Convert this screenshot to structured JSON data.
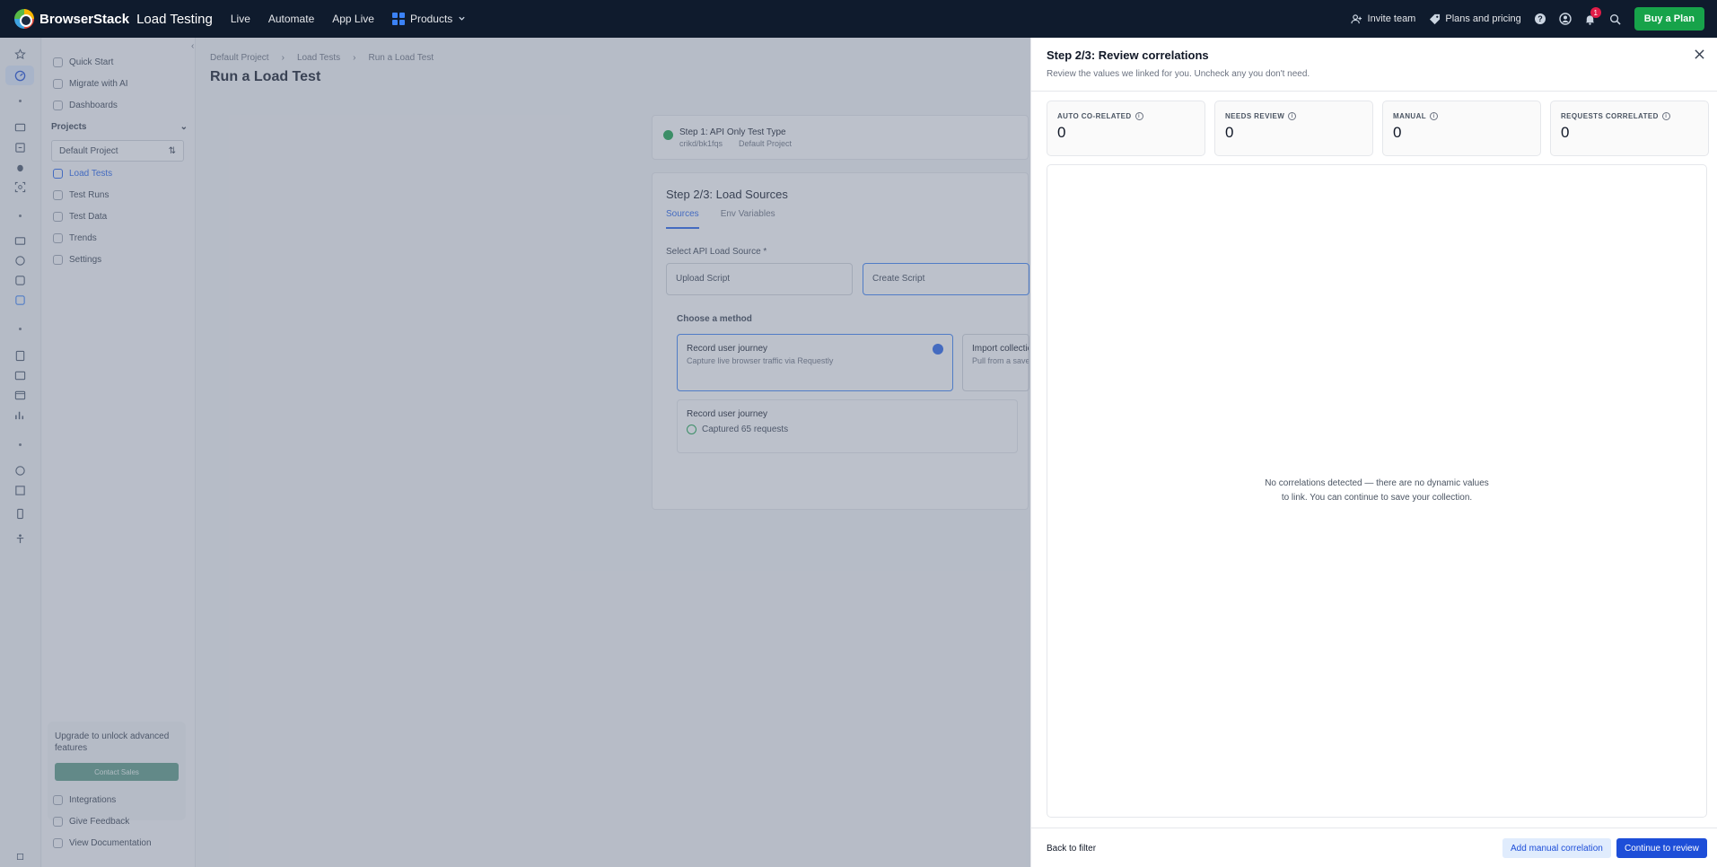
{
  "topbar": {
    "brand": "BrowserStack",
    "product": "Load Testing",
    "nav": [
      "Live",
      "Automate",
      "App Live"
    ],
    "products_label": "Products",
    "invite_label": "Invite team",
    "pricing_label": "Plans and pricing",
    "notification_count": "1",
    "buy_label": "Buy a Plan"
  },
  "sidebar": {
    "items_top": [
      "Quick Start",
      "Migrate with AI",
      "Dashboards"
    ],
    "projects_label": "Projects",
    "project_select": "Default Project",
    "project_items": [
      "Load Tests",
      "Test Runs",
      "Test Data",
      "Trends",
      "Settings"
    ],
    "upgrade_text": "Upgrade to unlock advanced features",
    "contact_label": "Contact Sales",
    "items_bottom": [
      "Integrations",
      "Give Feedback",
      "View Documentation"
    ]
  },
  "main": {
    "breadcrumbs": [
      "Default Project",
      "Load Tests",
      "Run a Load Test"
    ],
    "title": "Run a Load Test",
    "step1": {
      "title": "Step 1: API Only Test Type",
      "meta1": "crikd/bk1fqs",
      "meta2": "Default Project"
    },
    "step2": {
      "title": "Step 2/3: Load Sources",
      "tabs": [
        "Sources",
        "Env Variables"
      ],
      "source_label": "Select API Load Source *",
      "options": [
        "Upload Script",
        "Create Script"
      ],
      "method_label": "Choose a method",
      "method_record_title": "Record user journey",
      "method_record_sub": "Capture live browser traffic via Requestly",
      "method_import_title": "Import collection",
      "method_import_sub": "Pull from a saved",
      "recording_title": "Record user journey",
      "recording_status": "Captured 65 requests"
    }
  },
  "drawer": {
    "title": "Step 2/3: Review correlations",
    "subtitle": "Review the values we linked for you. Uncheck any you don't need.",
    "stats": [
      {
        "label": "AUTO CO-RELATED",
        "value": "0"
      },
      {
        "label": "NEEDS REVIEW",
        "value": "0"
      },
      {
        "label": "MANUAL",
        "value": "0"
      },
      {
        "label": "REQUESTS CORRELATED",
        "value": "0"
      }
    ],
    "empty_message": "No correlations detected — there are no dynamic values to link. You can continue to save your collection.",
    "back_label": "Back to filter",
    "add_manual_label": "Add manual correlation",
    "continue_label": "Continue to review"
  },
  "colors": {
    "topbar_bg": "#0f1b2d",
    "buy_button": "#17a34a",
    "primary": "#1d4ed8",
    "overlay": "rgba(107,118,140,0.45)"
  }
}
